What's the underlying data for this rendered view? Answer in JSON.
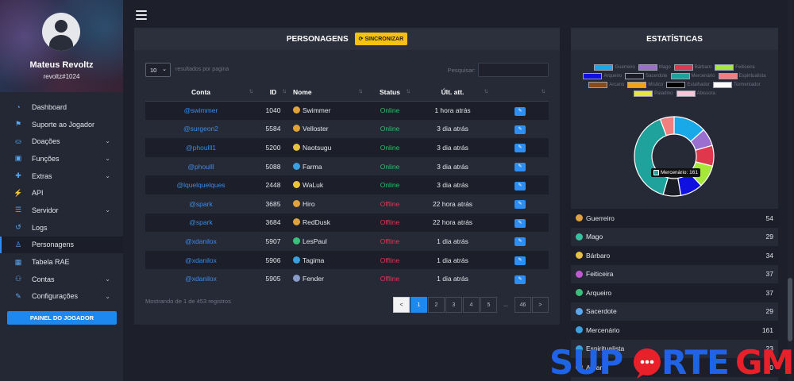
{
  "profile": {
    "name": "Mateus Revoltz",
    "tag": "revoltz#1024"
  },
  "menu": [
    {
      "label": "Dashboard",
      "icon": "speedometer-icon",
      "chevron": false,
      "active": false
    },
    {
      "label": "Suporte ao Jogador",
      "icon": "support-icon",
      "chevron": false,
      "active": false
    },
    {
      "label": "Doações",
      "icon": "donation-icon",
      "chevron": true,
      "active": false
    },
    {
      "label": "Funções",
      "icon": "functions-icon",
      "chevron": true,
      "active": false
    },
    {
      "label": "Extras",
      "icon": "puzzle-icon",
      "chevron": true,
      "active": false
    },
    {
      "label": "API",
      "icon": "plug-icon",
      "chevron": false,
      "active": false
    },
    {
      "label": "Servidor",
      "icon": "server-icon",
      "chevron": true,
      "active": false
    },
    {
      "label": "Logs",
      "icon": "history-icon",
      "chevron": false,
      "active": false
    },
    {
      "label": "Personagens",
      "icon": "user-icon",
      "chevron": false,
      "active": true
    },
    {
      "label": "Tabela RAE",
      "icon": "table-icon",
      "chevron": false,
      "active": false
    },
    {
      "label": "Contas",
      "icon": "users-icon",
      "chevron": true,
      "active": false
    },
    {
      "label": "Configurações",
      "icon": "wrench-icon",
      "chevron": true,
      "active": false
    }
  ],
  "sidebar_button": "PAINEL DO JOGADOR",
  "characters": {
    "title": "PERSONAGENS",
    "sync_label": "SINCRONIZAR",
    "page_size": "10",
    "per_page_label": "resultados por pagina",
    "search_label": "Pesquisar:",
    "columns": [
      "Conta",
      "ID",
      "Nome",
      "Status",
      "Últ. att.",
      ""
    ],
    "rows": [
      {
        "conta": "@swimmer",
        "id": "1040",
        "nome": "Swimmer",
        "vocation_color": "#e0a23a",
        "status": "Online",
        "last": "1 hora atrás"
      },
      {
        "conta": "@surgeon2",
        "id": "5584",
        "nome": "Velloster",
        "vocation_color": "#e0a23a",
        "status": "Online",
        "last": "3 dia atrás"
      },
      {
        "conta": "@phoulll1",
        "id": "5200",
        "nome": "Naotsugu",
        "vocation_color": "#e8c23a",
        "status": "Online",
        "last": "3 dia atrás"
      },
      {
        "conta": "@phoulll",
        "id": "5088",
        "nome": "Farma",
        "vocation_color": "#3aa0e0",
        "status": "Online",
        "last": "3 dia atrás"
      },
      {
        "conta": "@lquelquelques",
        "id": "2448",
        "nome": "WaLuk",
        "vocation_color": "#e8c23a",
        "status": "Online",
        "last": "3 dia atrás"
      },
      {
        "conta": "@spark",
        "id": "3685",
        "nome": "Hiro",
        "vocation_color": "#e0a23a",
        "status": "Offline",
        "last": "22 hora atrás"
      },
      {
        "conta": "@spark",
        "id": "3684",
        "nome": "RedDusk",
        "vocation_color": "#e0a23a",
        "status": "Offline",
        "last": "22 hora atrás"
      },
      {
        "conta": "@xdanilox",
        "id": "5907",
        "nome": "LesPaul",
        "vocation_color": "#3ac07a",
        "status": "Offline",
        "last": "1 dia atrás"
      },
      {
        "conta": "@xdanilox",
        "id": "5906",
        "nome": "Tagima",
        "vocation_color": "#3aa0e0",
        "status": "Offline",
        "last": "1 dia atrás"
      },
      {
        "conta": "@xdanilox",
        "id": "5905",
        "nome": "Fender",
        "vocation_color": "#8a9cc8",
        "status": "Offline",
        "last": "1 dia atrás"
      }
    ],
    "showing": "Mostrando de 1 de 453 registros",
    "pager": [
      {
        "label": "<",
        "kind": "prev"
      },
      {
        "label": "1",
        "kind": "act"
      },
      {
        "label": "2",
        "kind": ""
      },
      {
        "label": "3",
        "kind": ""
      },
      {
        "label": "4",
        "kind": ""
      },
      {
        "label": "5",
        "kind": ""
      },
      {
        "label": "...",
        "kind": "dots"
      },
      {
        "label": "46",
        "kind": ""
      },
      {
        "label": ">",
        "kind": ""
      }
    ]
  },
  "stats": {
    "title": "ESTATÍSTICAS",
    "tooltip": "Mercenário: 161",
    "items": [
      {
        "name": "Guerreiro",
        "value": 54,
        "color": "#1aa9e8",
        "icon_color": "#e0a23a"
      },
      {
        "name": "Mago",
        "value": 29,
        "color": "#9b6fd0",
        "icon_color": "#3ac0a0"
      },
      {
        "name": "Bárbaro",
        "value": 34,
        "color": "#e0374d",
        "icon_color": "#e8c23a"
      },
      {
        "name": "Feiticeira",
        "value": 37,
        "color": "#a6e83a",
        "icon_color": "#c05ad0"
      },
      {
        "name": "Arqueiro",
        "value": 37,
        "color": "#1010e0",
        "icon_color": "#3ac07a"
      },
      {
        "name": "Sacerdote",
        "value": 29,
        "color": "#1a1d26",
        "icon_color": "#5aa7f0"
      },
      {
        "name": "Mercenário",
        "value": 161,
        "color": "#1fa19c",
        "icon_color": "#3aa0e0"
      },
      {
        "name": "Espiritualista",
        "value": 23,
        "color": "#f08080",
        "icon_color": "#3aa0e0"
      },
      {
        "name": "Arcano",
        "value": 0,
        "color": "#8b4a1a",
        "icon_color": "#e0a23a"
      },
      {
        "name": "Místico",
        "value": 0,
        "color": "#f0a21a",
        "icon_color": "#e0a23a"
      },
      {
        "name": "Estalhador",
        "value": 0,
        "color": "#000000",
        "icon_color": "#e0a23a"
      },
      {
        "name": "Tormentador",
        "value": 0,
        "color": "#ffffff",
        "icon_color": "#e0a23a"
      },
      {
        "name": "Paladino",
        "value": 0,
        "color": "#e8e83a",
        "icon_color": "#e0a23a"
      },
      {
        "name": "Abissora",
        "value": 0,
        "color": "#f5c8d8",
        "icon_color": "#e0a23a"
      }
    ],
    "visible_rows": 9
  },
  "watermark": "SUPORTEGM"
}
